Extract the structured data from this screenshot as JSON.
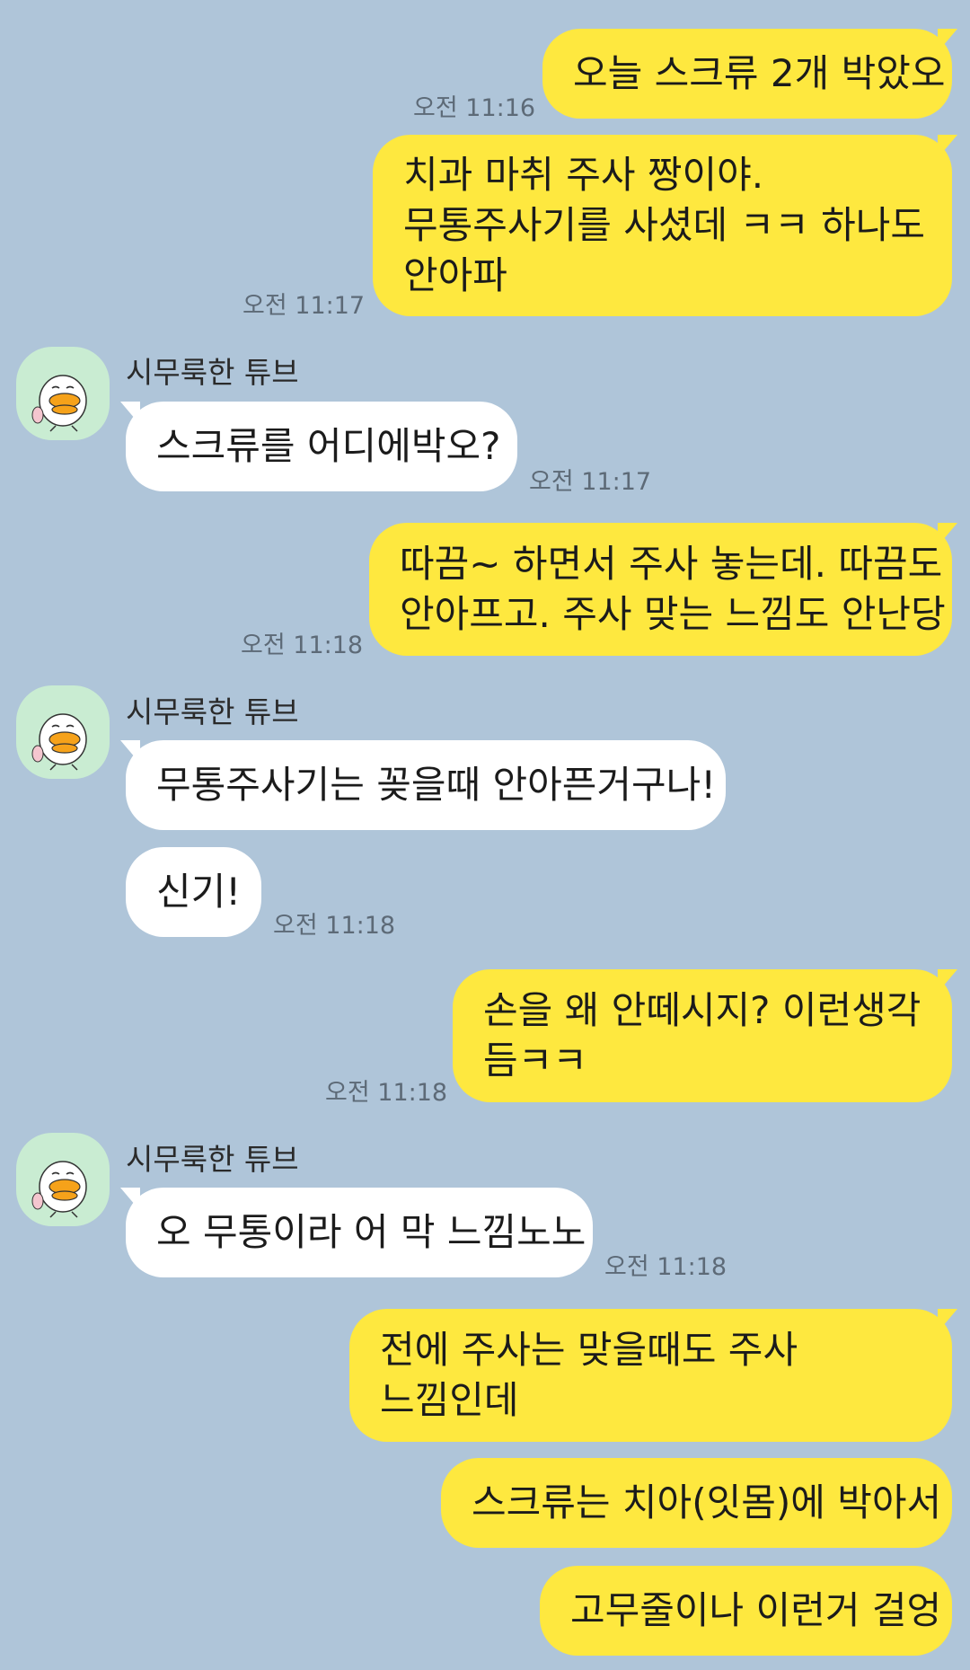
{
  "sender_name": "시무룩한 튜브",
  "messages": [
    {
      "side": "out",
      "lines": [
        "오늘 스크류 2개 박았오"
      ],
      "time": "오전 11:16"
    },
    {
      "side": "out",
      "lines": [
        "치과 마취 주사 짱이야.",
        "무통주사기를 사셨데 ㅋㅋ 하나도",
        "안아파"
      ],
      "time": "오전 11:17"
    },
    {
      "side": "in",
      "lines": [
        "스크류를 어디에박오?"
      ],
      "time": "오전 11:17"
    },
    {
      "side": "out",
      "lines": [
        "따끔~ 하면서 주사 놓는데. 따끔도",
        "안아프고. 주사 맞는 느낌도 안난당"
      ],
      "time": "오전 11:18"
    },
    {
      "side": "in",
      "lines": [
        "무통주사기는 꽂을때 안아픈거구나!"
      ]
    },
    {
      "side": "in",
      "lines": [
        "신기!"
      ],
      "time": "오전 11:18"
    },
    {
      "side": "out",
      "lines": [
        "손을 왜 안떼시지? 이런생각",
        "듬ㅋㅋ"
      ],
      "time": "오전 11:18"
    },
    {
      "side": "in",
      "lines": [
        "오 무통이라 어 막 느낌노노"
      ],
      "time": "오전 11:18"
    },
    {
      "side": "out",
      "lines": [
        "전에 주사는 맞을때도 주사",
        "느낌인데"
      ]
    },
    {
      "side": "out",
      "lines": [
        "스크류는 치아(잇몸)에 박아서"
      ]
    },
    {
      "side": "out",
      "lines": [
        "고무줄이나 이런거 걸엉"
      ]
    }
  ],
  "colors": {
    "background": "#afc5d9",
    "outgoing_bubble": "#fee83f",
    "incoming_bubble": "#ffffff",
    "avatar_bg": "#c9ecd2"
  },
  "icons": {
    "avatar": "tube-duck-avatar-icon"
  }
}
